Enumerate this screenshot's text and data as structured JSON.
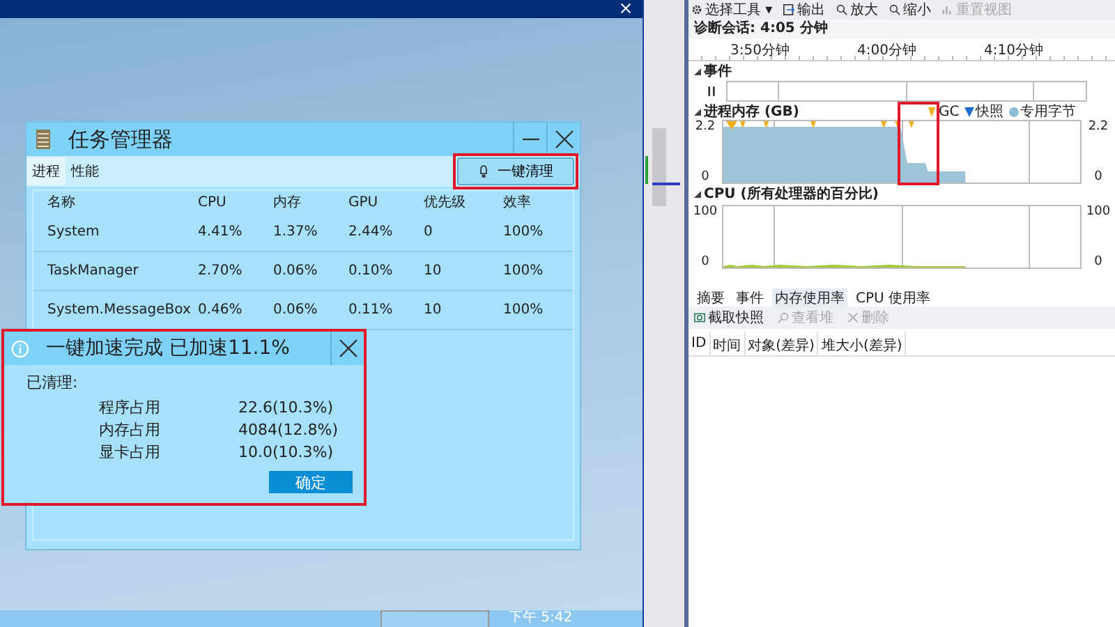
{
  "desktop": {
    "task_manager": {
      "title": "任务管理器",
      "tabs": [
        {
          "label": "进程",
          "selected": true
        },
        {
          "label": "性能",
          "selected": false
        }
      ],
      "clean_button": "一键清理",
      "columns": [
        "名称",
        "CPU",
        "内存",
        "GPU",
        "优先级",
        "效率"
      ],
      "rows": [
        [
          "System",
          "4.41%",
          "1.37%",
          "2.44%",
          "0",
          "100%"
        ],
        [
          "TaskManager",
          "2.70%",
          "0.06%",
          "0.10%",
          "10",
          "100%"
        ],
        [
          "System.MessageBox",
          "0.46%",
          "0.06%",
          "0.11%",
          "10",
          "100%"
        ]
      ]
    },
    "message_box": {
      "title": "一键加速完成 已加速11.1%",
      "heading": "已清理:",
      "items": [
        {
          "label": "程序占用",
          "value": "22.6(10.3%)"
        },
        {
          "label": "内存占用",
          "value": "4084(12.8%)"
        },
        {
          "label": "显卡占用",
          "value": "10.0(10.3%)"
        }
      ],
      "ok_button": "确定"
    },
    "taskbar": {
      "clock": "下午 5:42"
    }
  },
  "diagnostics": {
    "toolbar": [
      {
        "label": "选择工具 ▾",
        "kind": "gear",
        "disabled": false
      },
      {
        "label": "输出",
        "kind": "output",
        "disabled": false
      },
      {
        "label": "放大",
        "kind": "zoom",
        "disabled": false
      },
      {
        "label": "缩小",
        "kind": "zoom",
        "disabled": false
      },
      {
        "label": "重置视图",
        "kind": "reset",
        "disabled": true
      }
    ],
    "session": "诊断会话: 4:05 分钟",
    "ruler_labels": [
      "3:50分钟",
      "4:00分钟",
      "4:10分钟"
    ],
    "events_title": "事件",
    "memory": {
      "title": "进程内存 (GB)",
      "legend": [
        {
          "label": "GC",
          "kind": "gc"
        },
        {
          "label": "快照",
          "kind": "snapshot"
        },
        {
          "label": "专用字节",
          "kind": "bytes"
        }
      ],
      "left_axis": [
        "2.2",
        "0"
      ],
      "right_axis": [
        "2.2",
        "0"
      ]
    },
    "cpu": {
      "title": "CPU (所有处理器的百分比)",
      "left_axis": [
        "100",
        "0"
      ],
      "right_axis": [
        "100",
        "0"
      ]
    },
    "tabs": [
      {
        "label": "摘要",
        "selected": false
      },
      {
        "label": "事件",
        "selected": false
      },
      {
        "label": "内存使用率",
        "selected": true
      },
      {
        "label": "CPU 使用率",
        "selected": false
      }
    ],
    "actions": [
      {
        "label": "截取快照",
        "kind": "camera",
        "disabled": false
      },
      {
        "label": "查看堆",
        "kind": "search",
        "disabled": true
      },
      {
        "label": "删除",
        "kind": "delete",
        "disabled": true
      }
    ],
    "columns": [
      "ID",
      "时间",
      "对象(差异)",
      "堆大小(差异)"
    ]
  }
}
